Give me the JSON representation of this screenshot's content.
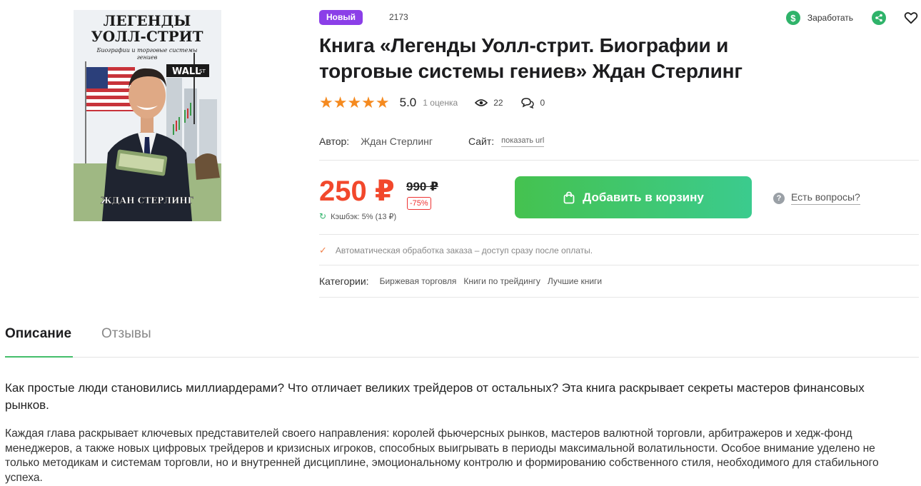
{
  "cover": {
    "title_line1": "ЛЕГЕНДЫ",
    "title_line2": "УОЛЛ-СТРИТ",
    "subtitle_line1": "Биографии и торговые системы",
    "subtitle_line2": "гениев",
    "street_sign": "WALL",
    "street_sign_small": "ST",
    "author": "ЖДАН СТЕРЛИНГ"
  },
  "badge": "Новый",
  "top_views": "2173",
  "actions": {
    "earn_label": "Заработать",
    "earn_icon": "dollar-icon",
    "share_icon": "share-icon",
    "favorite_icon": "heart-icon"
  },
  "title": "Книга «Легенды Уолл-стрит. Биографии и торговые системы гениев» Ждан Стерлинг",
  "rating": {
    "stars": "★★★★★",
    "value": "5.0",
    "count": "1 оценка",
    "views": "22",
    "comments": "0"
  },
  "meta": {
    "author_label": "Автор:",
    "author": "Ждан Стерлинг",
    "site_label": "Сайт:",
    "site_link": "показать url"
  },
  "price": {
    "current": "250 ₽",
    "old": "990 ₽",
    "discount": "-75%",
    "cashback": "Кэшбэк: 5% (13 ₽)"
  },
  "cart_button": "Добавить в корзину",
  "questions": "Есть вопросы?",
  "auto_processing": "Автоматическая обработка заказа – доступ сразу после оплаты.",
  "categories": {
    "label": "Категории:",
    "items": [
      "Биржевая торговля",
      "Книги по трейдингу",
      "Лучшие книги"
    ]
  },
  "tabs": {
    "description": "Описание",
    "reviews": "Отзывы"
  },
  "description": {
    "p1": "Как простые люди становились миллиардерами? Что отличает великих трейдеров от остальных? Эта книга раскрывает секреты мастеров финансовых рынков.",
    "p2": "Каждая глава раскрывает ключевых представителей своего направления: королей фьючерсных рынков, мастеров валютной торговли, арбитражеров и хедж-фонд менеджеров, а также новых цифровых трейдеров и кризисных игроков, способных выигрывать в периоды максимальной волатильности. Особое внимание уделено не только методикам и системам торговли, но и внутренней дисциплине, эмоциональному контролю и формированию собственного стиля, необходимого для стабильного успеха."
  },
  "colors": {
    "accent_green": "#44be6a",
    "price_red": "#f2482c",
    "badge_purple": "#8b3fe8",
    "star_orange": "#f58a1f"
  }
}
